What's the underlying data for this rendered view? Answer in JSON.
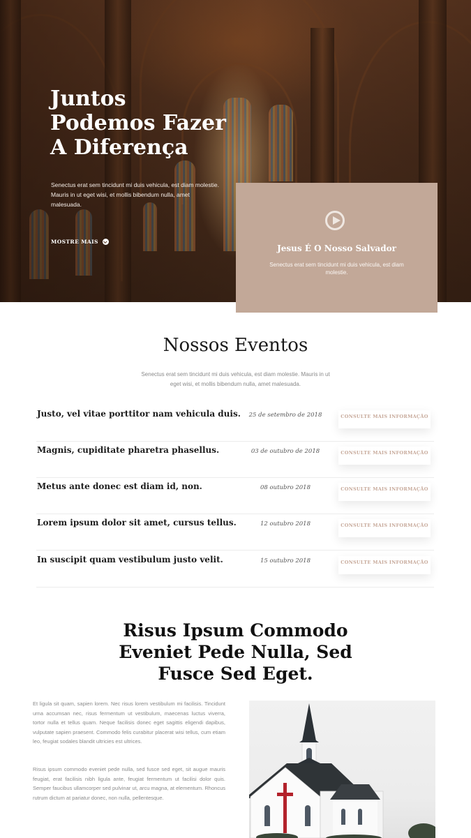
{
  "hero": {
    "title": "Juntos Podemos Fazer A Diferença",
    "text": "Senectus erat sem tincidunt mi duis vehicula, est diam molestie. Mauris in ut eget wisi, et mollis bibendum nulla, amet malesuada.",
    "more_label": "MOSTRE MAIS"
  },
  "video": {
    "title": "Jesus É O Nosso Salvador",
    "text": "Senectus erat sem tincidunt mi duis vehicula, est diam molestie."
  },
  "events": {
    "title": "Nossos Eventos",
    "subtitle": "Senectus erat sem tincidunt mi duis vehicula, est diam molestie. Mauris in ut eget wisi, et mollis bibendum nulla, amet malesuada.",
    "button_label": "CONSULTE MAIS INFORMAÇÃO",
    "items": [
      {
        "name": "Justo, vel vitae porttitor nam vehicula duis.",
        "date": "25 de setembro de 2018"
      },
      {
        "name": "Magnis, cupiditate pharetra phasellus.",
        "date": "03 de outubro de 2018"
      },
      {
        "name": "Metus ante donec est diam id, non.",
        "date": "08 outubro 2018"
      },
      {
        "name": "Lorem ipsum dolor sit amet, cursus tellus.",
        "date": "12 outubro 2018"
      },
      {
        "name": "In suscipit quam vestibulum justo velit.",
        "date": "15 outubro 2018"
      }
    ]
  },
  "about": {
    "title": "Risus Ipsum Commodo Eveniet Pede Nulla, Sed Fusce Sed Eget.",
    "paragraph1": "Et ligula sit quam, sapien lorem. Nec risus lorem vestibulum mi facilisis. Tincidunt urna accumsan nec, risus fermentum ut vestibulum, maecenas luctus viverra, tortor nulla et tellus quam. Neque facilisis donec eget sagittis eligendi dapibus, vulputate sapien praesent. Commodo felis curabitur placerat wisi tellus, cum etiam leo, feugiat sodales blandit ultricies est ultrices.",
    "paragraph2": "Risus ipsum commodo eveniet pede nulla, sed fusce sed eget, sit augue mauris feugiat, erat facilisis nibh ligula ante, feugiat fermentum ut facilisi dolor quis. Semper faucibus ullamcorper sed pulvinar ut, arcu magna, at elementum. Rhoncus rutrum dictum at pariatur donec, non nulla, pellentesque."
  },
  "colors": {
    "accent": "#c2a898",
    "button_text": "#c7a99a",
    "hero_overlay": "#4a2c1a"
  }
}
